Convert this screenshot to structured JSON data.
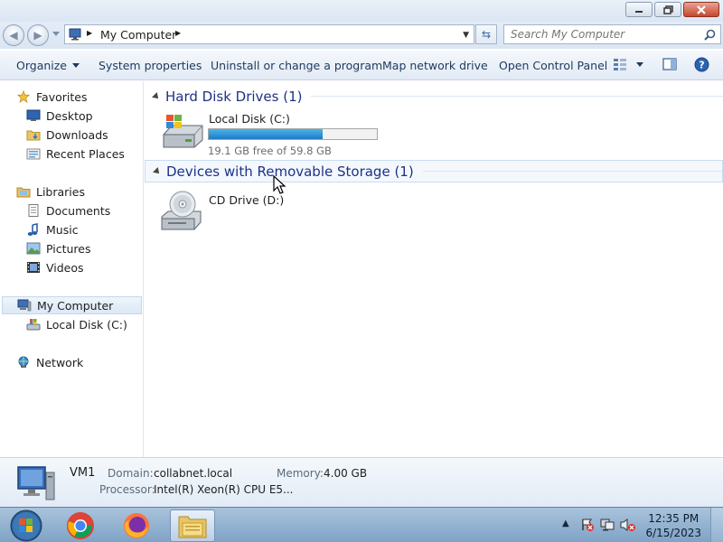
{
  "window": {
    "minimize_label": "Minimize",
    "maximize_label": "Maximize",
    "close_label": "Close"
  },
  "address": {
    "location": "My Computer",
    "search_placeholder": "Search My Computer"
  },
  "command_bar": {
    "organize": "Organize",
    "system_properties": "System properties",
    "uninstall": "Uninstall or change a program",
    "map_network_drive": "Map network drive",
    "open_control_panel": "Open Control Panel"
  },
  "nav": {
    "favorites": "Favorites",
    "desktop": "Desktop",
    "downloads": "Downloads",
    "recent_places": "Recent Places",
    "libraries": "Libraries",
    "documents": "Documents",
    "music": "Music",
    "pictures": "Pictures",
    "videos": "Videos",
    "my_computer": "My Computer",
    "local_disk": "Local Disk (C:)",
    "network": "Network"
  },
  "content": {
    "group_hdd": "Hard Disk Drives (1)",
    "group_removable": "Devices with Removable Storage (1)",
    "drive_c": {
      "name": "Local Disk (C:)",
      "free_text": "19.1 GB free of 59.8 GB",
      "used_fraction": 0.68
    },
    "drive_d": {
      "name": "CD Drive (D:)"
    }
  },
  "details": {
    "computer_name": "VM1",
    "domain_label": "Domain:",
    "domain_value": "collabnet.local",
    "memory_label": "Memory:",
    "memory_value": "4.00 GB",
    "processor_label": "Processor:",
    "processor_value": "Intel(R) Xeon(R) CPU E5..."
  },
  "taskbar": {
    "time": "12:35 PM",
    "date": "6/15/2023"
  },
  "colors": {
    "accent": "#1e3287",
    "bar_fill": "#1f7bc7"
  }
}
